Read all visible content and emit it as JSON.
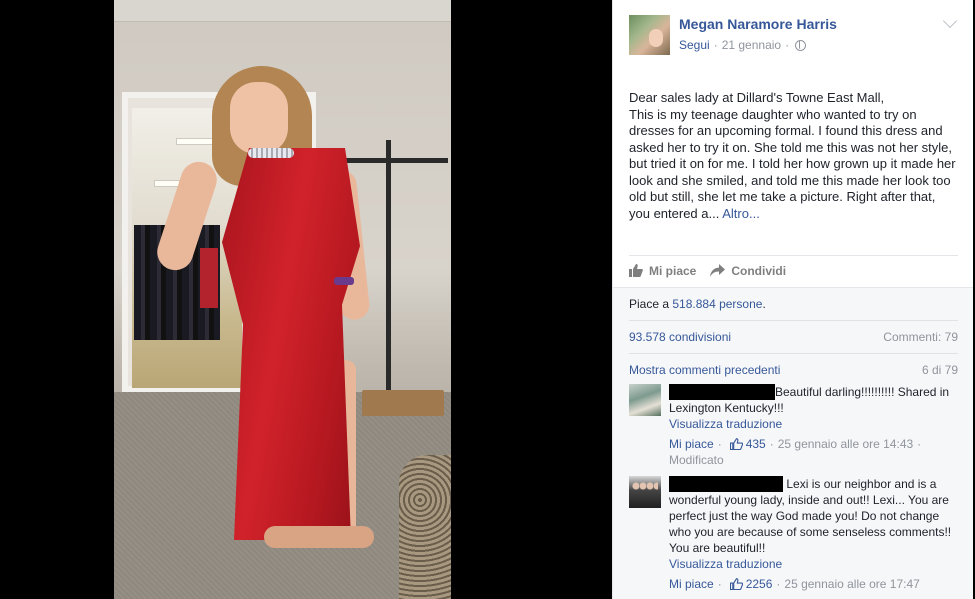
{
  "post": {
    "author": "Megan Naramore Harris",
    "follow": "Segui",
    "date": "21 gennaio",
    "body_lines": [
      "Dear sales lady at Dillard's Towne East Mall,",
      "This is my teenage daughter who wanted to try on dresses for an upcoming formal. I found this dress and asked her to try it on. She told me this was not her style, but tried it on for me. I told her how grown up it made her look and she smiled, and told me this made her look too old but still, she let me take a picture. Right after that, you entered a..."
    ],
    "more": "Altro...",
    "icons": [
      "globe-icon",
      "chevron-down-icon"
    ]
  },
  "actions": {
    "like": "Mi piace",
    "share": "Condividi"
  },
  "feedback": {
    "likes_prefix": "Piace a ",
    "likes_count": "518.884 persone",
    "likes_suffix": ".",
    "shares": "93.578 condivisioni",
    "comments": "Commenti: 79",
    "prev_comments": "Mostra commenti precedenti",
    "pager": "6 di 79"
  },
  "comments": [
    {
      "text": "Beautiful darling!!!!!!!!!! Shared in Lexington Kentucky!!!",
      "translate": "Visualizza traduzione",
      "like": "Mi piace",
      "likes": "435",
      "time": "25 gennaio alle ore 14:43",
      "edited": "Modificato"
    },
    {
      "text": "Lexi is our neighbor and is a wonderful young lady, inside and out!! Lexi... You are perfect just the way God made you! Do not change who you are because of some senseless comments!! You are beautiful!!",
      "translate": "Visualizza traduzione",
      "like": "Mi piace",
      "likes": "2256",
      "time": "25 gennaio alle ore 17:47",
      "edited": ""
    }
  ],
  "colors": {
    "link": "#365899",
    "muted": "#90949c",
    "text": "#1d2129",
    "dress": "#c41e26"
  }
}
